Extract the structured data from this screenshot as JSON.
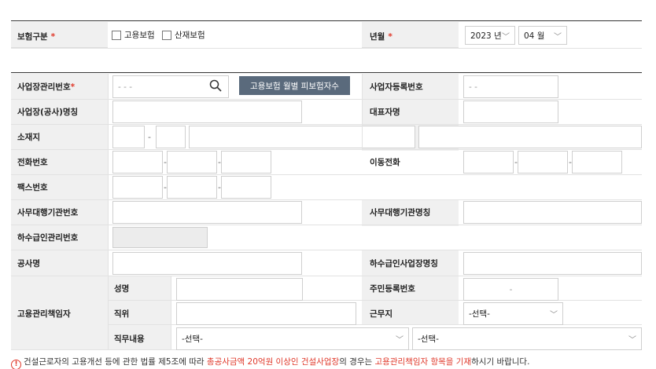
{
  "insurance_type": {
    "label": "보험구분",
    "required_mark": "*",
    "opt_employment": "고용보험",
    "opt_industrial": "산재보험"
  },
  "year_month": {
    "label": "년월",
    "required_mark": "*",
    "year": "2023 년",
    "month": "04 월"
  },
  "biz_mgmt_no": {
    "label": "사업장관리번호",
    "required_mark": "*",
    "placeholder": "- - -",
    "btn_label": "고용보험 월별 피보험자수"
  },
  "biz_reg_no": {
    "label": "사업자등록번호",
    "placeholder": "- -"
  },
  "biz_name": {
    "label": "사업장(공사)명칭"
  },
  "representative": {
    "label": "대표자명"
  },
  "address": {
    "label": "소재지",
    "sep": "-"
  },
  "phone": {
    "label": "전화번호",
    "sep": "-"
  },
  "mobile": {
    "label": "이동전화",
    "sep": "-"
  },
  "fax": {
    "label": "팩스번호",
    "sep": "-"
  },
  "agency_no": {
    "label": "사무대행기관번호"
  },
  "agency_name": {
    "label": "사무대행기관명칭"
  },
  "subcontract_no": {
    "label": "하수급인관리번호"
  },
  "project_name": {
    "label": "공사명"
  },
  "subcontract_name": {
    "label": "하수급인사업장명칭"
  },
  "manager": {
    "label": "고용관리책임자",
    "name_label": "성명",
    "rrn_label": "주민등록번호",
    "rrn_placeholder": "-",
    "position_label": "직위",
    "workplace_label": "근무지",
    "workplace_value": "-선택-",
    "duty_label": "직무내용",
    "duty_value1": "-선택-",
    "duty_value2": "-선택-"
  },
  "notice": {
    "part1": "건설근로자의 고용개선 등에 관한 법률 제5조에 따라 ",
    "part2": "총공사금액 20억원 이상인 건설사업장",
    "part3": "의 경우는 ",
    "part4": "고용관리책임자 항목을 기재",
    "part5": "하시기 바랍니다."
  }
}
